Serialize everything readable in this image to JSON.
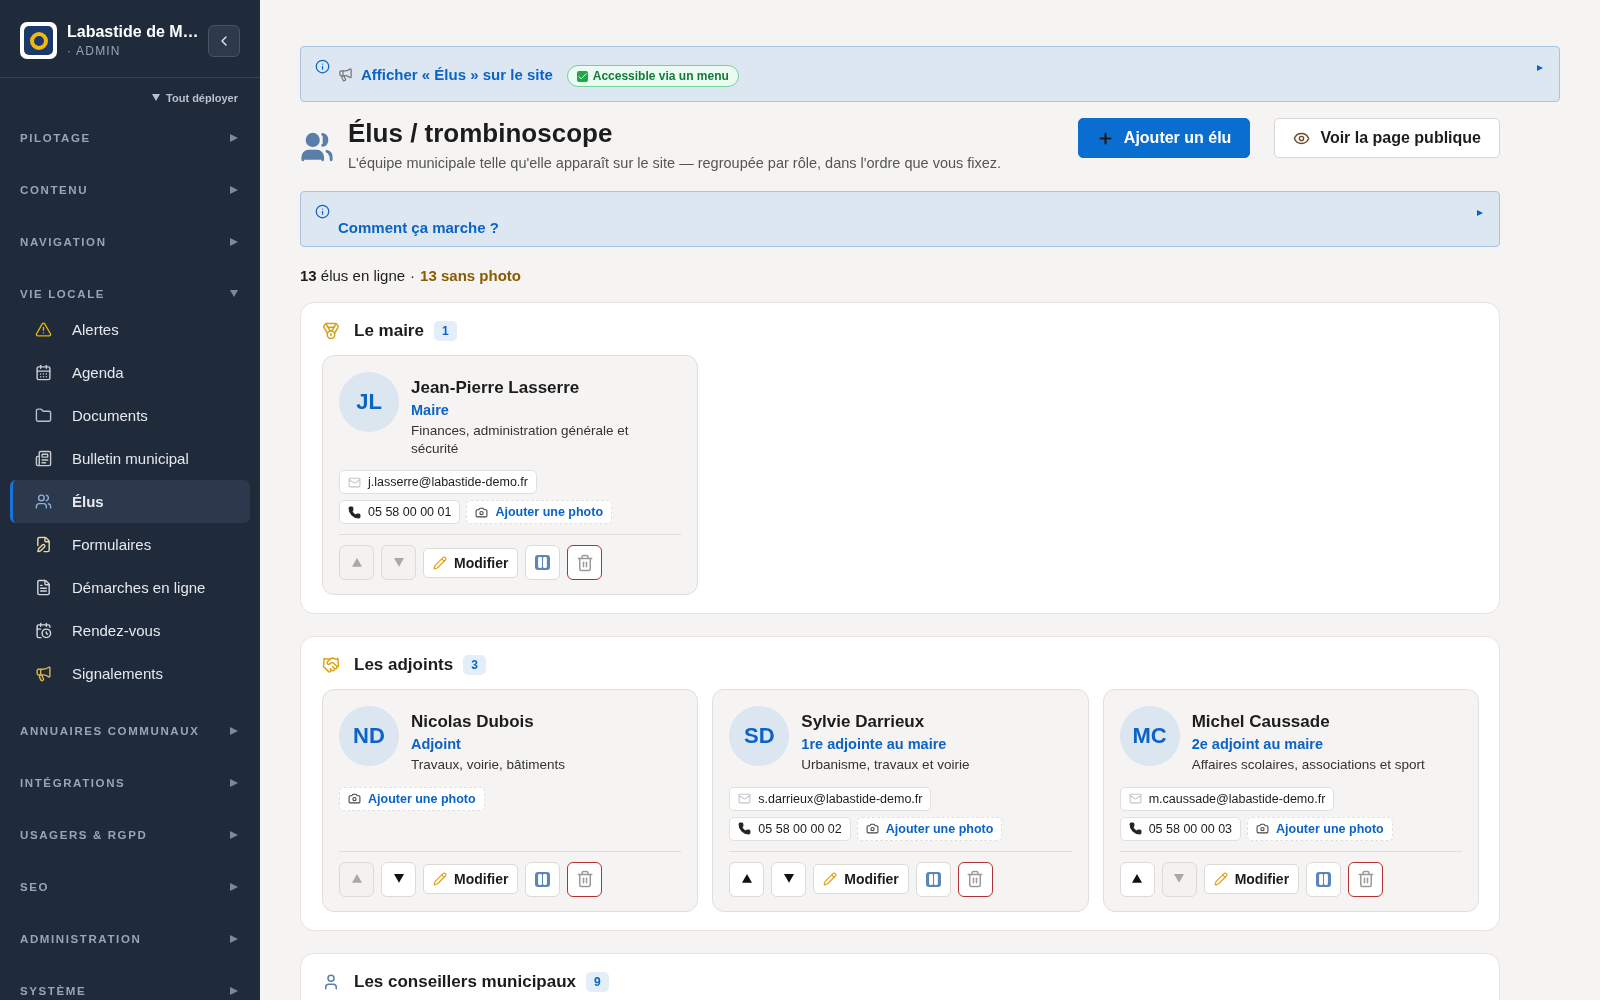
{
  "sidebar": {
    "brand": {
      "name": "Labastide de M…",
      "role": "· ADMIN"
    },
    "expand_all": "Tout déployer",
    "sections": [
      {
        "label": "PILOTAGE",
        "expanded": false
      },
      {
        "label": "CONTENU",
        "expanded": false
      },
      {
        "label": "NAVIGATION",
        "expanded": false
      },
      {
        "label": "VIE LOCALE",
        "expanded": true,
        "items": [
          {
            "label": "Alertes",
            "selected": false
          },
          {
            "label": "Agenda",
            "selected": false
          },
          {
            "label": "Documents",
            "selected": false
          },
          {
            "label": "Bulletin municipal",
            "selected": false
          },
          {
            "label": "Élus",
            "selected": true
          },
          {
            "label": "Formulaires",
            "selected": false
          },
          {
            "label": "Démarches en ligne",
            "selected": false
          },
          {
            "label": "Rendez-vous",
            "selected": false
          },
          {
            "label": "Signalements",
            "selected": false
          }
        ]
      },
      {
        "label": "ANNUAIRES COMMUNAUX",
        "expanded": false
      },
      {
        "label": "INTÉGRATIONS",
        "expanded": false
      },
      {
        "label": "USAGERS & RGPD",
        "expanded": false
      },
      {
        "label": "SEO",
        "expanded": false
      },
      {
        "label": "ADMINISTRATION",
        "expanded": false
      },
      {
        "label": "SYSTÈME",
        "expanded": false
      }
    ]
  },
  "visibility_banner": {
    "link": "Afficher « Élus » sur le site",
    "badge": "Accessible via un menu"
  },
  "header": {
    "title": "Élus / trombinoscope",
    "subtitle": "L'équipe municipale telle qu'elle apparaît sur le site — regroupée par rôle, dans l'ordre que vous fixez.",
    "buttons": [
      {
        "kind": "primary",
        "label": "Ajouter un élu"
      },
      {
        "kind": "secondary",
        "label": "Voir la page publique"
      }
    ]
  },
  "help_banner": {
    "link": "Comment ça marche ?"
  },
  "stats": {
    "online": "**13** élus en ligne",
    "separator": "·",
    "no_photo": "13 sans photo"
  },
  "groups": [
    {
      "title": "Le maire",
      "count": "1",
      "cards": [
        {
          "initials": "JL",
          "name": "Jean-Pierre Lasserre",
          "role": "Maire",
          "description": "Finances, administration générale et sécurité",
          "email": "j.lasserre@labastide-demo.fr",
          "phone": "05 58 00 00 01",
          "photo_action": "Ajouter une photo",
          "up_disabled": true,
          "down_disabled": true,
          "edit": "Modifier"
        }
      ]
    },
    {
      "title": "Les adjoints",
      "count": "3",
      "cards": [
        {
          "initials": "ND",
          "name": "Nicolas Dubois",
          "role": "Adjoint",
          "description": "Travaux, voirie, bâtiments",
          "photo_action": "Ajouter une photo",
          "up_disabled": true,
          "down_disabled": false,
          "edit": "Modifier"
        },
        {
          "initials": "SD",
          "name": "Sylvie Darrieux",
          "role": "1re adjointe au maire",
          "description": "Urbanisme, travaux et voirie",
          "email": "s.darrieux@labastide-demo.fr",
          "phone": "05 58 00 00 02",
          "photo_action": "Ajouter une photo",
          "up_disabled": false,
          "down_disabled": false,
          "edit": "Modifier"
        },
        {
          "initials": "MC",
          "name": "Michel Caussade",
          "role": "2e adjoint au maire",
          "description": "Affaires scolaires, associations et sport",
          "email": "m.caussade@labastide-demo.fr",
          "phone": "05 58 00 00 03",
          "photo_action": "Ajouter une photo",
          "up_disabled": false,
          "down_disabled": true,
          "edit": "Modifier"
        }
      ]
    },
    {
      "title": "Les conseillers municipaux",
      "count": "9"
    }
  ]
}
